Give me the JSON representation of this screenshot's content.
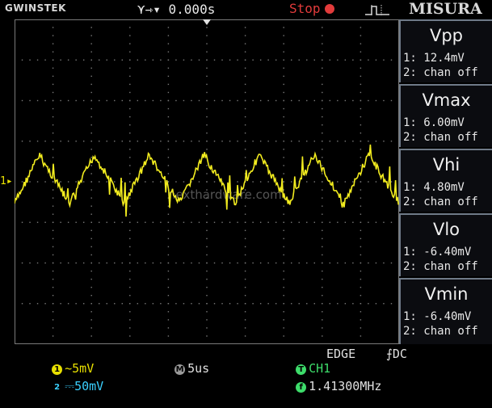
{
  "header": {
    "brand_prefix": "GW",
    "brand_name": "INSTEK",
    "timebase_offset": "⋎⇾▾ 0.000s",
    "run_state": "Stop",
    "mode_label": "MISURA"
  },
  "measurements": [
    {
      "title": "Vpp",
      "line1": "1: 12.4mV",
      "line2": "2: chan off"
    },
    {
      "title": "Vmax",
      "line1": "1: 6.00mV",
      "line2": "2: chan off"
    },
    {
      "title": "Vhi",
      "line1": "1: 4.80mV",
      "line2": "2: chan off"
    },
    {
      "title": "Vlo",
      "line1": "1: -6.40mV",
      "line2": "2: chan off"
    },
    {
      "title": "Vmin",
      "line1": "1: -6.40mV",
      "line2": "2: chan off"
    }
  ],
  "status": {
    "ch1_badge": "1",
    "ch1_scale": "~5mV",
    "ch2_badge": "2",
    "ch2_scale": "⎓50mV",
    "time_badge": "M",
    "time_div": "5us",
    "trigger_badge": "T",
    "trigger_source": "CH1",
    "trigger_type": "EDGE",
    "trigger_coupling": "⨍DC",
    "freq_badge": "f",
    "frequency": "1.41300MHz"
  },
  "screen": {
    "ch1_marker": "1▸",
    "watermark": "nexthardware.com"
  },
  "colors": {
    "trace": "#f2ec1f",
    "grid": "#7a7a7a",
    "stop": "#e23b3b",
    "ch1": "#e8e000",
    "ch2": "#3ad0ff",
    "trigger": "#3ddc6a"
  }
}
